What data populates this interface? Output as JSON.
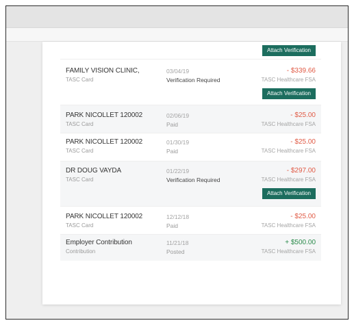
{
  "transactions": [
    {
      "merchant": "",
      "method": "",
      "date": "",
      "status": "",
      "amount": "",
      "account": "",
      "attach_label": "Attach Verification"
    },
    {
      "merchant": "FAMILY VISION CLINIC,",
      "method": "TASC Card",
      "date": "03/04/19",
      "status": "Verification Required",
      "amount": "- $339.66",
      "account": "TASC Healthcare FSA",
      "attach_label": "Attach Verification"
    },
    {
      "merchant": "PARK NICOLLET 120002",
      "method": "TASC Card",
      "date": "02/06/19",
      "status": "Paid",
      "amount": "- $25.00",
      "account": "TASC Healthcare FSA"
    },
    {
      "merchant": "PARK NICOLLET 120002",
      "method": "TASC Card",
      "date": "01/30/19",
      "status": "Paid",
      "amount": "- $25.00",
      "account": "TASC Healthcare FSA"
    },
    {
      "merchant": "DR DOUG VAYDA",
      "method": "TASC Card",
      "date": "01/22/19",
      "status": "Verification Required",
      "amount": "- $297.00",
      "account": "TASC Healthcare FSA",
      "attach_label": "Attach Verification"
    },
    {
      "merchant": "PARK NICOLLET 120002",
      "method": "TASC Card",
      "date": "12/12/18",
      "status": "Paid",
      "amount": "- $25.00",
      "account": "TASC Healthcare FSA"
    },
    {
      "merchant": "Employer Contribution",
      "method": "Contribution",
      "date": "11/21/18",
      "status": "Posted",
      "amount": "+ $500.00",
      "account": "TASC Healthcare FSA"
    }
  ],
  "colors": {
    "button_bg": "#1c6d5e",
    "debit": "#e05a45",
    "credit": "#2a8a4a"
  }
}
